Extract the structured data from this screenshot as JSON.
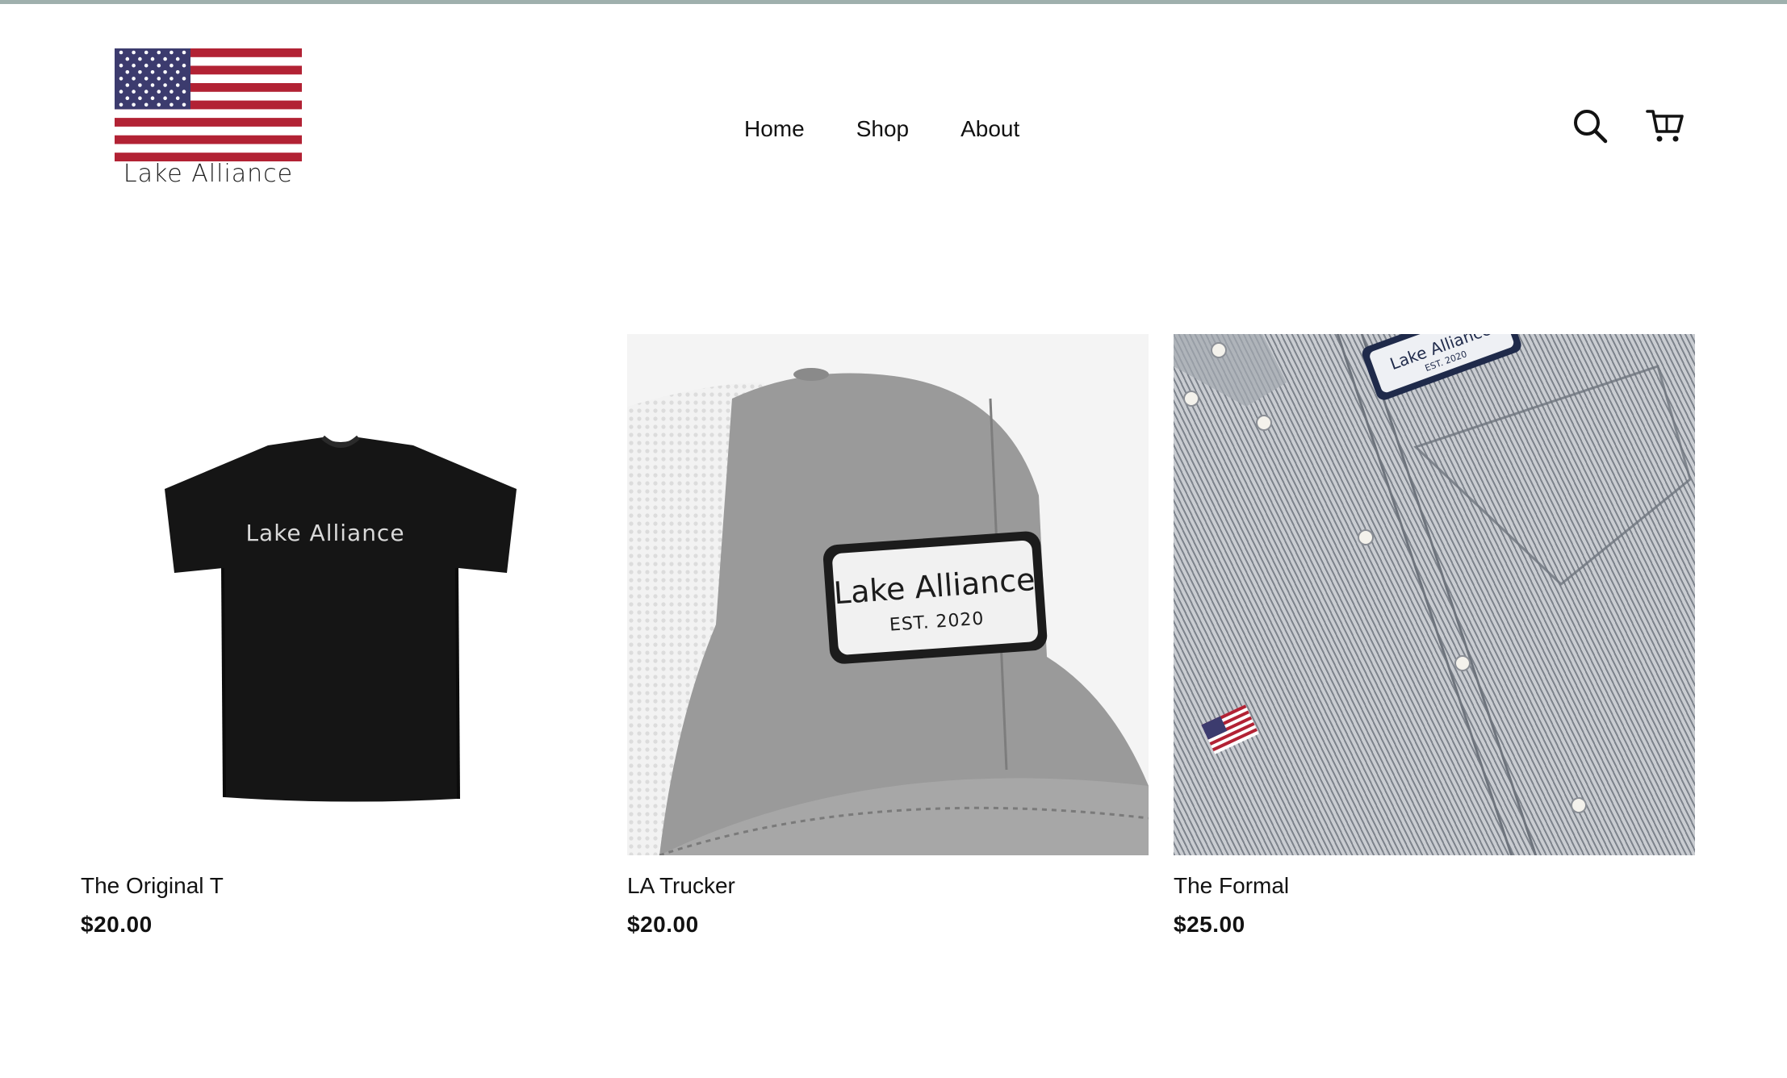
{
  "brand": {
    "name": "Lake Alliance",
    "logo_icon": "us-flag-icon"
  },
  "nav": {
    "items": [
      {
        "label": "Home"
      },
      {
        "label": "Shop"
      },
      {
        "label": "About"
      }
    ]
  },
  "header_icons": {
    "search": "search-icon",
    "cart": "cart-icon"
  },
  "products": [
    {
      "title": "The Original T",
      "price": "$20.00",
      "image_icon": "black-tshirt-image",
      "print_text": "Lake Alliance"
    },
    {
      "title": "LA Trucker",
      "price": "$20.00",
      "image_icon": "trucker-hat-image",
      "patch_text": "Lake Alliance",
      "patch_subtext": "EST. 2020"
    },
    {
      "title": "The Formal",
      "price": "$25.00",
      "image_icon": "striped-shirt-image",
      "patch_text": "Lake Alliance",
      "patch_subtext": "EST. 2020"
    }
  ],
  "colors": {
    "flag_red": "#b22234",
    "flag_blue": "#3c3b6e",
    "text": "#121212",
    "top_rule": "#9fb0ad"
  }
}
